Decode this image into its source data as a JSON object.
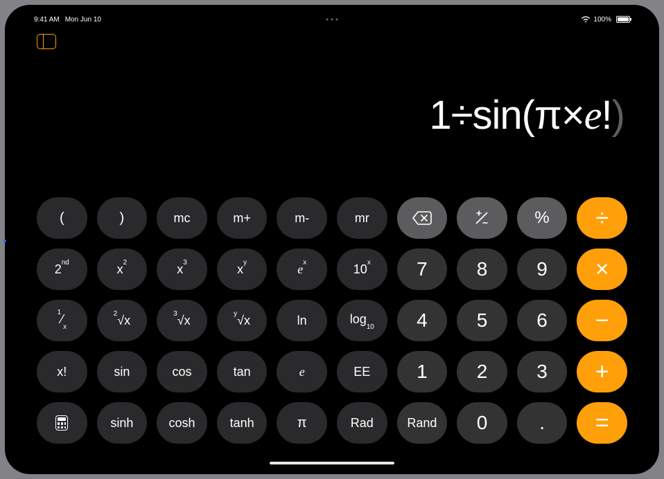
{
  "status": {
    "time": "9:41 AM",
    "date": "Mon Jun 10",
    "battery_pct": "100%"
  },
  "sidebar": {
    "toggle_label": "Toggle Sidebar"
  },
  "display": {
    "expression": "1÷sin(π×e!)",
    "plain": "1÷sin(π×e!",
    "trailing_paren": ")"
  },
  "keys": {
    "r1": {
      "lparen": "(",
      "rparen": ")",
      "mc": "mc",
      "mplus": "m+",
      "mminus": "m-",
      "mr": "mr",
      "backspace": "⌫",
      "plusminus": "⁺⁄₋",
      "percent": "%",
      "divide": "÷"
    },
    "r2": {
      "second": "2",
      "second_sup": "nd",
      "x2": "x",
      "x2_sup": "2",
      "x3": "x",
      "x3_sup": "3",
      "xy": "x",
      "xy_sup": "y",
      "ex": "e",
      "ex_sup": "x",
      "tenx": "10",
      "tenx_sup": "x",
      "d7": "7",
      "d8": "8",
      "d9": "9",
      "multiply": "×"
    },
    "r3": {
      "inv": "¹⁄ₓ",
      "sqrt": "²√x",
      "cbrt": "³√x",
      "yroot": "ʸ√x",
      "ln": "ln",
      "log10": "log",
      "log10_sub": "10",
      "d4": "4",
      "d5": "5",
      "d6": "6",
      "minus": "−"
    },
    "r4": {
      "fact": "x!",
      "sin": "sin",
      "cos": "cos",
      "tan": "tan",
      "e": "e",
      "EE": "EE",
      "d1": "1",
      "d2": "2",
      "d3": "3",
      "plus": "+"
    },
    "r5": {
      "mode": "Mode",
      "sinh": "sinh",
      "cosh": "cosh",
      "tanh": "tanh",
      "pi": "π",
      "rad": "Rad",
      "rand": "Rand",
      "d0": "0",
      "dot": ".",
      "equals": "="
    }
  },
  "colors": {
    "accent": "#ff9f0a",
    "dark": "#2a2a2c",
    "num": "#333333",
    "light": "#5c5c5e"
  }
}
